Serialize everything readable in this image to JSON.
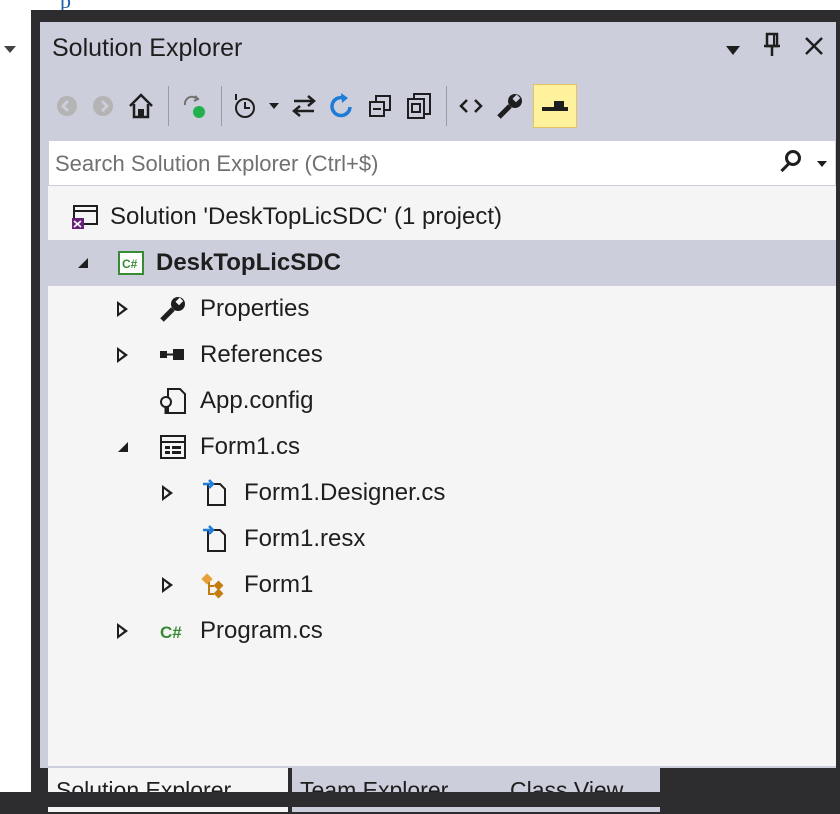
{
  "panel": {
    "title": "Solution Explorer"
  },
  "search": {
    "placeholder": "Search Solution Explorer (Ctrl+$)"
  },
  "tree": {
    "solution": "Solution 'DeskTopLicSDC' (1 project)",
    "project": "DeskTopLicSDC",
    "items": {
      "properties": "Properties",
      "references": "References",
      "app_config": "App.config",
      "form1_cs": "Form1.cs",
      "form1_designer": "Form1.Designer.cs",
      "form1_resx": "Form1.resx",
      "form1": "Form1",
      "program_cs": "Program.cs"
    }
  },
  "tabs": [
    "Solution Explorer",
    "Team Explorer",
    "Class View"
  ],
  "colors": {
    "accent": "#68217a",
    "selected": "#cccedb",
    "csharp": "#388a34",
    "arrow": "#1e7bd6",
    "highlight": "#fff29d"
  }
}
